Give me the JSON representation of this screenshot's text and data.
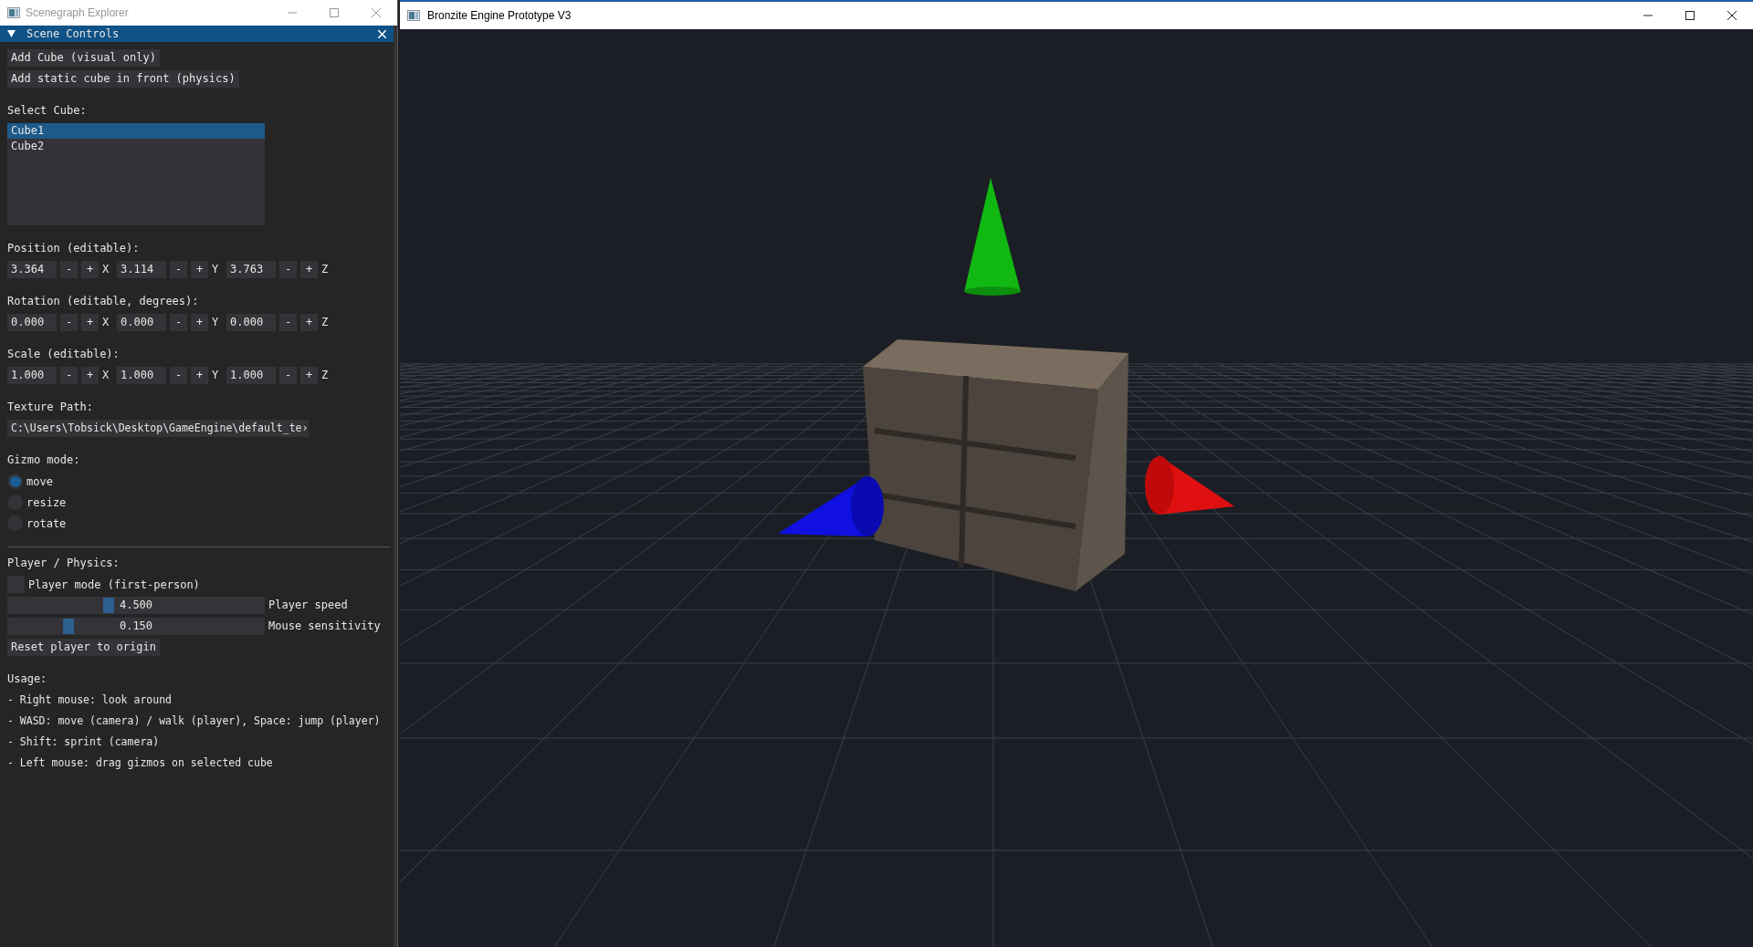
{
  "left_window": {
    "title": "Scenegraph Explorer"
  },
  "panel": {
    "title": "Scene Controls",
    "expanded": true,
    "buttons": [
      "Add Cube (visual only)",
      "Add static cube in front (physics)"
    ],
    "select_label": "Select Cube:",
    "cubes": [
      {
        "label": "Cube1",
        "selected": true
      },
      {
        "label": "Cube2",
        "selected": false
      }
    ],
    "vectors": [
      {
        "label": "Position (editable):",
        "components": [
          {
            "value": "3.364",
            "minus": "-",
            "plus": "+",
            "axis": "X"
          },
          {
            "value": "3.114",
            "minus": "-",
            "plus": "+",
            "axis": "Y"
          },
          {
            "value": "3.763",
            "minus": "-",
            "plus": "+",
            "axis": "Z"
          }
        ]
      },
      {
        "label": "Rotation (editable, degrees):",
        "components": [
          {
            "value": "0.000",
            "minus": "-",
            "plus": "+",
            "axis": "X"
          },
          {
            "value": "0.000",
            "minus": "-",
            "plus": "+",
            "axis": "Y"
          },
          {
            "value": "0.000",
            "minus": "-",
            "plus": "+",
            "axis": "Z"
          }
        ]
      },
      {
        "label": "Scale (editable):",
        "components": [
          {
            "value": "1.000",
            "minus": "-",
            "plus": "+",
            "axis": "X"
          },
          {
            "value": "1.000",
            "minus": "-",
            "plus": "+",
            "axis": "Y"
          },
          {
            "value": "1.000",
            "minus": "-",
            "plus": "+",
            "axis": "Z"
          }
        ]
      }
    ],
    "texture_label": "Texture Path:",
    "texture_path": "C:\\Users\\Tobsick\\Desktop\\GameEngine\\default_te›",
    "gizmo_label": "Gizmo mode:",
    "gizmo_modes": [
      {
        "label": "move",
        "selected": true
      },
      {
        "label": "resize",
        "selected": false
      },
      {
        "label": "rotate",
        "selected": false
      }
    ],
    "player_label": "Player / Physics:",
    "player_mode": {
      "label": "Player mode (first-person)",
      "checked": false
    },
    "sliders": [
      {
        "value": "4.500",
        "label": "Player speed",
        "level": 0.39
      },
      {
        "value": "0.150",
        "label": "Mouse sensitivity",
        "level": 0.225
      }
    ],
    "reset_button": "Reset player to origin",
    "usage_label": "Usage:",
    "usage": [
      "- Right mouse: look around",
      "- WASD: move (camera) / walk (player), Space: jump (player)",
      "- Shift: sprint (camera)",
      "- Left mouse: drag gizmos on selected cube"
    ]
  },
  "main_window": {
    "title": "Bronzite Engine Prototype V3"
  }
}
